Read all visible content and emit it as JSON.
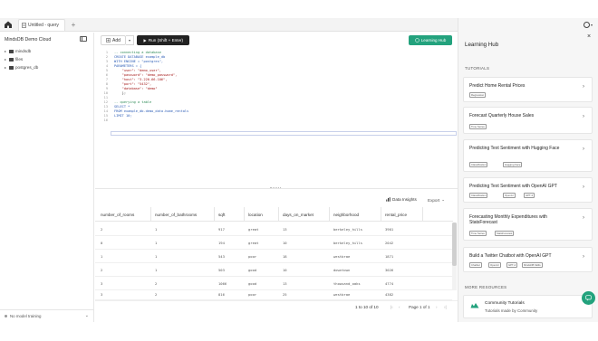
{
  "tabs": {
    "active_label": "Untitled - query",
    "add_label": "+"
  },
  "sidebar": {
    "title": "MindsDB Demo Cloud",
    "items": [
      {
        "label": "mindsdb"
      },
      {
        "label": "files"
      },
      {
        "label": "postgres_db"
      }
    ],
    "footer_text": "No model training"
  },
  "toolbar": {
    "add_label": "Add",
    "run_label": "Run (Shift + Enter)",
    "learning_label": "Learning Hub"
  },
  "editor": {
    "line_numbers": [
      "1",
      "2",
      "3",
      "4",
      "5",
      "6",
      "7",
      "8",
      "9",
      "10",
      "11",
      "12",
      "13",
      "14",
      "15",
      "16"
    ],
    "lines": [
      "-- connecting a database",
      "CREATE DATABASE example_db",
      "WITH ENGINE = \"postgres\",",
      "PARAMETERS = {",
      "    \"user\": \"demo_user\",",
      "    \"password\": \"demo_password\",",
      "    \"host\": \"3.220.66.106\",",
      "    \"port\": \"5432\",",
      "    \"database\": \"demo\"",
      "    };",
      "",
      "-- querying a table",
      "SELECT *",
      "FROM example_db.demo_data.home_rentals",
      "LIMIT 10;",
      ""
    ]
  },
  "results": {
    "insights_label": "Data Insights",
    "export_label": "Export",
    "columns": [
      "number_of_rooms",
      "number_of_bathrooms",
      "sqft",
      "location",
      "days_on_market",
      "neighborhood",
      "rental_price"
    ],
    "rows": [
      [
        "2",
        "1",
        "917",
        "great",
        "13",
        "berkeley_hills",
        "3901"
      ],
      [
        "0",
        "1",
        "194",
        "great",
        "10",
        "berkeley_hills",
        "2042"
      ],
      [
        "1",
        "1",
        "543",
        "poor",
        "18",
        "westbrae",
        "1871"
      ],
      [
        "2",
        "1",
        "503",
        "good",
        "10",
        "downtown",
        "3026"
      ],
      [
        "3",
        "2",
        "1066",
        "good",
        "13",
        "thowsand_oaks",
        "4774"
      ],
      [
        "3",
        "2",
        "816",
        "poor",
        "25",
        "westbrae",
        "4382"
      ]
    ],
    "pager_range": "1 to 10 of 10",
    "pager_page": "Page 1 of 1"
  },
  "panel": {
    "title": "Learning Hub",
    "tutorials_heading": "TUTORIALS",
    "tutorials": [
      {
        "title": "Predict Home Rental Prices",
        "tags": [
          "Regression"
        ]
      },
      {
        "title": "Forecast Quarterly House Sales",
        "tags": [
          "Time Series"
        ]
      },
      {
        "title": "Predicting Text Sentiment with Hugging Face",
        "tags": [
          "Classification",
          "Hugging Face"
        ]
      },
      {
        "title": "Predicting Text Sentiment with OpenAI GPT",
        "tags": [
          "Classification",
          "OpenAI",
          "GPT-3"
        ]
      },
      {
        "title": "Forecasting Monthly Expenditures with StatsForecast",
        "tags": [
          "Time Series",
          "StatsForecast"
        ]
      },
      {
        "title": "Build a Twitter Chatbot with OpenAI GPT",
        "tags": [
          "Chatbot",
          "OpenAI",
          "GPT-4",
          "MindsDB Skills"
        ]
      }
    ],
    "more_heading": "MORE RESOURCES",
    "community_title": "Community Tutorials",
    "community_sub": "Tutorials made by Community"
  },
  "colors": {
    "accent": "#23a27d",
    "run_button": "#222222"
  },
  "icons": [
    "home-icon",
    "query-file-icon",
    "sidebar-collapse-icon",
    "folder-icon",
    "plus-icon",
    "play-icon",
    "help-circle-icon",
    "chart-icon",
    "chevron-down-icon",
    "chevron-right-icon",
    "close-icon",
    "user-icon",
    "community-icon",
    "chat-icon"
  ]
}
